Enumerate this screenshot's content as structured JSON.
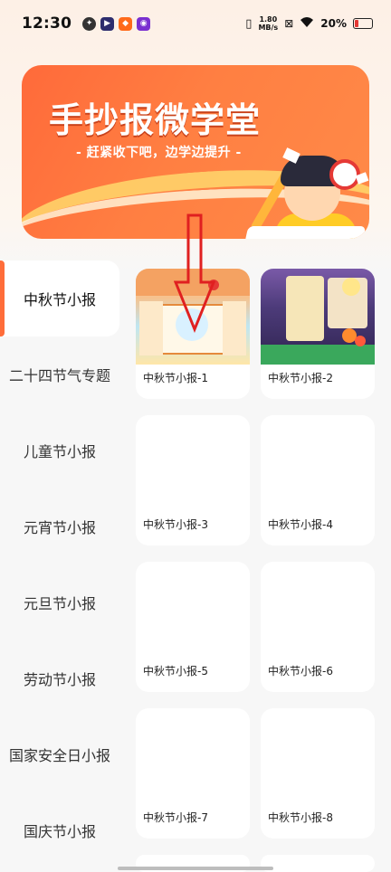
{
  "status_bar": {
    "time": "12:30",
    "net_speed": "1.80",
    "net_unit": "MB/s",
    "battery": "20%"
  },
  "banner": {
    "title": "手抄报微学堂",
    "subtitle": "- 赶紧收下吧，边学边提升 -"
  },
  "sidebar": {
    "items": [
      {
        "label": "中秋节小报",
        "active": true
      },
      {
        "label": "二十四节气专题",
        "active": false
      },
      {
        "label": "儿童节小报",
        "active": false
      },
      {
        "label": "元宵节小报",
        "active": false
      },
      {
        "label": "元旦节小报",
        "active": false
      },
      {
        "label": "劳动节小报",
        "active": false
      },
      {
        "label": "国家安全日小报",
        "active": false
      },
      {
        "label": "国庆节小报",
        "active": false
      }
    ]
  },
  "grid": {
    "cards": [
      {
        "label": "中秋节小报-1"
      },
      {
        "label": "中秋节小报-2"
      },
      {
        "label": "中秋节小报-3"
      },
      {
        "label": "中秋节小报-4"
      },
      {
        "label": "中秋节小报-5"
      },
      {
        "label": "中秋节小报-6"
      },
      {
        "label": "中秋节小报-7"
      },
      {
        "label": "中秋节小报-8"
      }
    ]
  },
  "colors": {
    "accent": "#ff6d3a",
    "arrow": "#e02020"
  }
}
